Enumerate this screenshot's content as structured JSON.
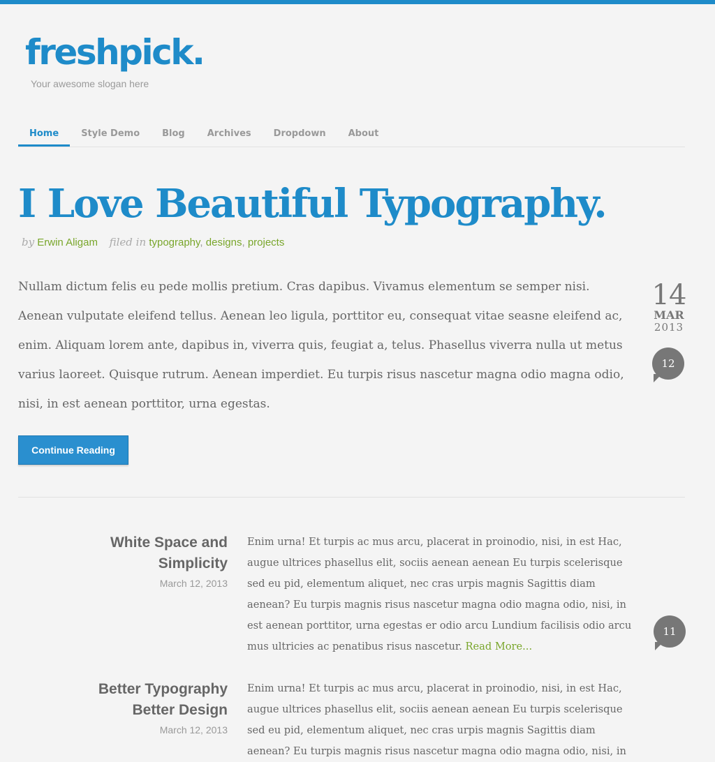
{
  "header": {
    "logo": "freshpick.",
    "slogan": "Your awesome slogan here"
  },
  "nav": {
    "items": [
      "Home",
      "Style Demo",
      "Blog",
      "Archives",
      "Dropdown",
      "About"
    ],
    "active": "Home"
  },
  "featured": {
    "title": "I Love Beautiful Typography.",
    "by_label": "by",
    "author": "Erwin Aligam",
    "filed_label": "filed in",
    "tags": [
      "typography",
      "designs",
      "projects"
    ],
    "excerpt": "Nullam dictum felis eu pede mollis pretium. Cras dapibus. Vivamus elementum se semper nisi. Aenean vulputate eleifend tellus. Aenean leo ligula, porttitor eu, consequat vitae seasne eleifend ac, enim. Aliquam lorem ante, dapibus in, viverra quis, feugiat a, telus. Phasellus viverra nulla ut metus varius laoreet. Quisque rutrum. Aenean imperdiet. Eu turpis risus nascetur magna odio magna odio, nisi, in est aenean porttitor, urna egestas.",
    "date": {
      "day": "14",
      "month": "MAR",
      "year": "2013"
    },
    "comments": "12",
    "button": "Continue Reading"
  },
  "posts": [
    {
      "title_line1": "White Space and",
      "title_line2": "Simplicity",
      "date": "March 12, 2013",
      "excerpt": "Enim urna! Et turpis ac mus arcu, placerat in proinodio, nisi, in est Hac, augue ultrices phasellus elit, sociis aenean aenean Eu turpis scelerisque sed eu pid, elementum aliquet, nec cras urpis magnis Sagittis diam aenean? Eu turpis magnis risus nascetur magna odio magna odio, nisi, in est aenean porttitor, urna egestas er odio arcu Lundium facilisis odio arcu mus ultricies ac penatibus risus nascetur.",
      "read_more": "Read More...",
      "comments": "11"
    },
    {
      "title_line1": "Better Typography",
      "title_line2": "Better Design",
      "date": "March 12, 2013",
      "excerpt": "Enim urna! Et turpis ac mus arcu, placerat in proinodio, nisi, in est Hac, augue ultrices phasellus elit, sociis aenean aenean Eu turpis scelerisque sed eu pid, elementum aliquet, nec cras urpis magnis Sagittis diam aenean? Eu turpis magnis risus nascetur magna odio magna odio, nisi, in",
      "read_more": "",
      "comments": ""
    }
  ],
  "colors": {
    "accent": "#1e8bc9",
    "tag_link": "#79a62b",
    "background": "#f4f4f4",
    "bubble": "#777777"
  }
}
